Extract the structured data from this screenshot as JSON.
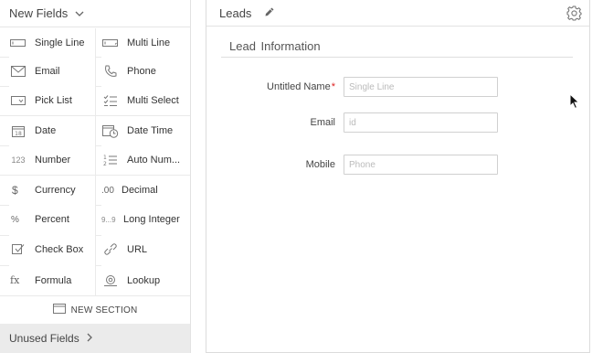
{
  "palette": {
    "header_label": "New Fields",
    "fields": [
      {
        "label": "Single Line",
        "icon": "single-line-icon"
      },
      {
        "label": "Multi Line",
        "icon": "multi-line-icon"
      },
      {
        "label": "Email",
        "icon": "envelope-icon"
      },
      {
        "label": "Phone",
        "icon": "phone-icon"
      },
      {
        "label": "Pick List",
        "icon": "picklist-icon"
      },
      {
        "label": "Multi Select",
        "icon": "multi-select-icon"
      },
      {
        "label": "Date",
        "icon": "calendar-icon",
        "glyph": "18"
      },
      {
        "label": "Date Time",
        "icon": "calendar-clock-icon"
      },
      {
        "label": "Number",
        "icon": "number-icon",
        "glyph": "123"
      },
      {
        "label": "Auto Num...",
        "icon": "auto-number-icon"
      },
      {
        "label": "Currency",
        "icon": "dollar-icon",
        "glyph": "$"
      },
      {
        "label": "Decimal",
        "icon": "decimal-icon",
        "glyph": ".00"
      },
      {
        "label": "Percent",
        "icon": "percent-icon",
        "glyph": "%"
      },
      {
        "label": "Long Integer",
        "icon": "long-integer-icon",
        "glyph": "9...9"
      },
      {
        "label": "Check Box",
        "icon": "checkbox-icon"
      },
      {
        "label": "URL",
        "icon": "link-icon"
      },
      {
        "label": "Formula",
        "icon": "formula-icon",
        "glyph": "fx"
      },
      {
        "label": "Lookup",
        "icon": "lookup-icon"
      }
    ],
    "new_section_label": "NEW SECTION",
    "unused_fields_label": "Unused Fields"
  },
  "layout": {
    "module_name": "Leads",
    "section_title": "Lead  Information",
    "fields": [
      {
        "label": "Untitled Name",
        "required": true,
        "required_mark": "*",
        "placeholder": "Single Line"
      },
      {
        "label": "Email",
        "required": false,
        "placeholder": "id"
      },
      {
        "label": "Mobile",
        "required": false,
        "placeholder": "Phone"
      }
    ]
  },
  "colors": {
    "required": "#dd2222",
    "panel_footer": "#ebebeb"
  }
}
